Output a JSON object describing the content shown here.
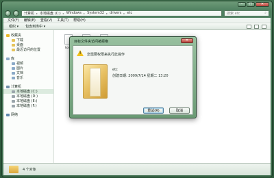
{
  "window": {
    "caption": {
      "minimize": "–",
      "maximize": "□",
      "close": "✕"
    }
  },
  "address": {
    "crumbs": [
      "计算机",
      "本地磁盘 (C:)",
      "Windows",
      "System32",
      "drivers",
      "etc"
    ],
    "search_placeholder": "搜索 etc"
  },
  "menu": [
    "文件(F)",
    "编辑(E)",
    "查看(V)",
    "工具(T)",
    "帮助(H)"
  ],
  "toolbar": {
    "organize": "组织 ▾",
    "include": "包含到库中 ▾"
  },
  "navpane": {
    "favorites": {
      "label": "收藏夹",
      "items": [
        "下载",
        "桌面",
        "最近访问的位置"
      ]
    },
    "libraries": {
      "label": "库",
      "items": [
        "视频",
        "图片",
        "文档",
        "音乐"
      ]
    },
    "computer": {
      "label": "计算机",
      "items": [
        "本地磁盘 (C:)",
        "本地磁盘 (D:)",
        "本地磁盘 (E:)",
        "本地磁盘 (F:)"
      ]
    },
    "network": {
      "label": "网络"
    }
  },
  "files": [
    {
      "name": "hosts"
    },
    {
      "name": ""
    },
    {
      "name": ""
    }
  ],
  "status": {
    "count": "4 个对象"
  },
  "dialog": {
    "title": "目标文件夹访问被拒绝",
    "message": "您需要权限来执行此操作",
    "item_name": "etc",
    "item_date": "创建日期: 2009/7/14 星期二 13:20",
    "retry": "重试(R)",
    "cancel": "取消"
  }
}
